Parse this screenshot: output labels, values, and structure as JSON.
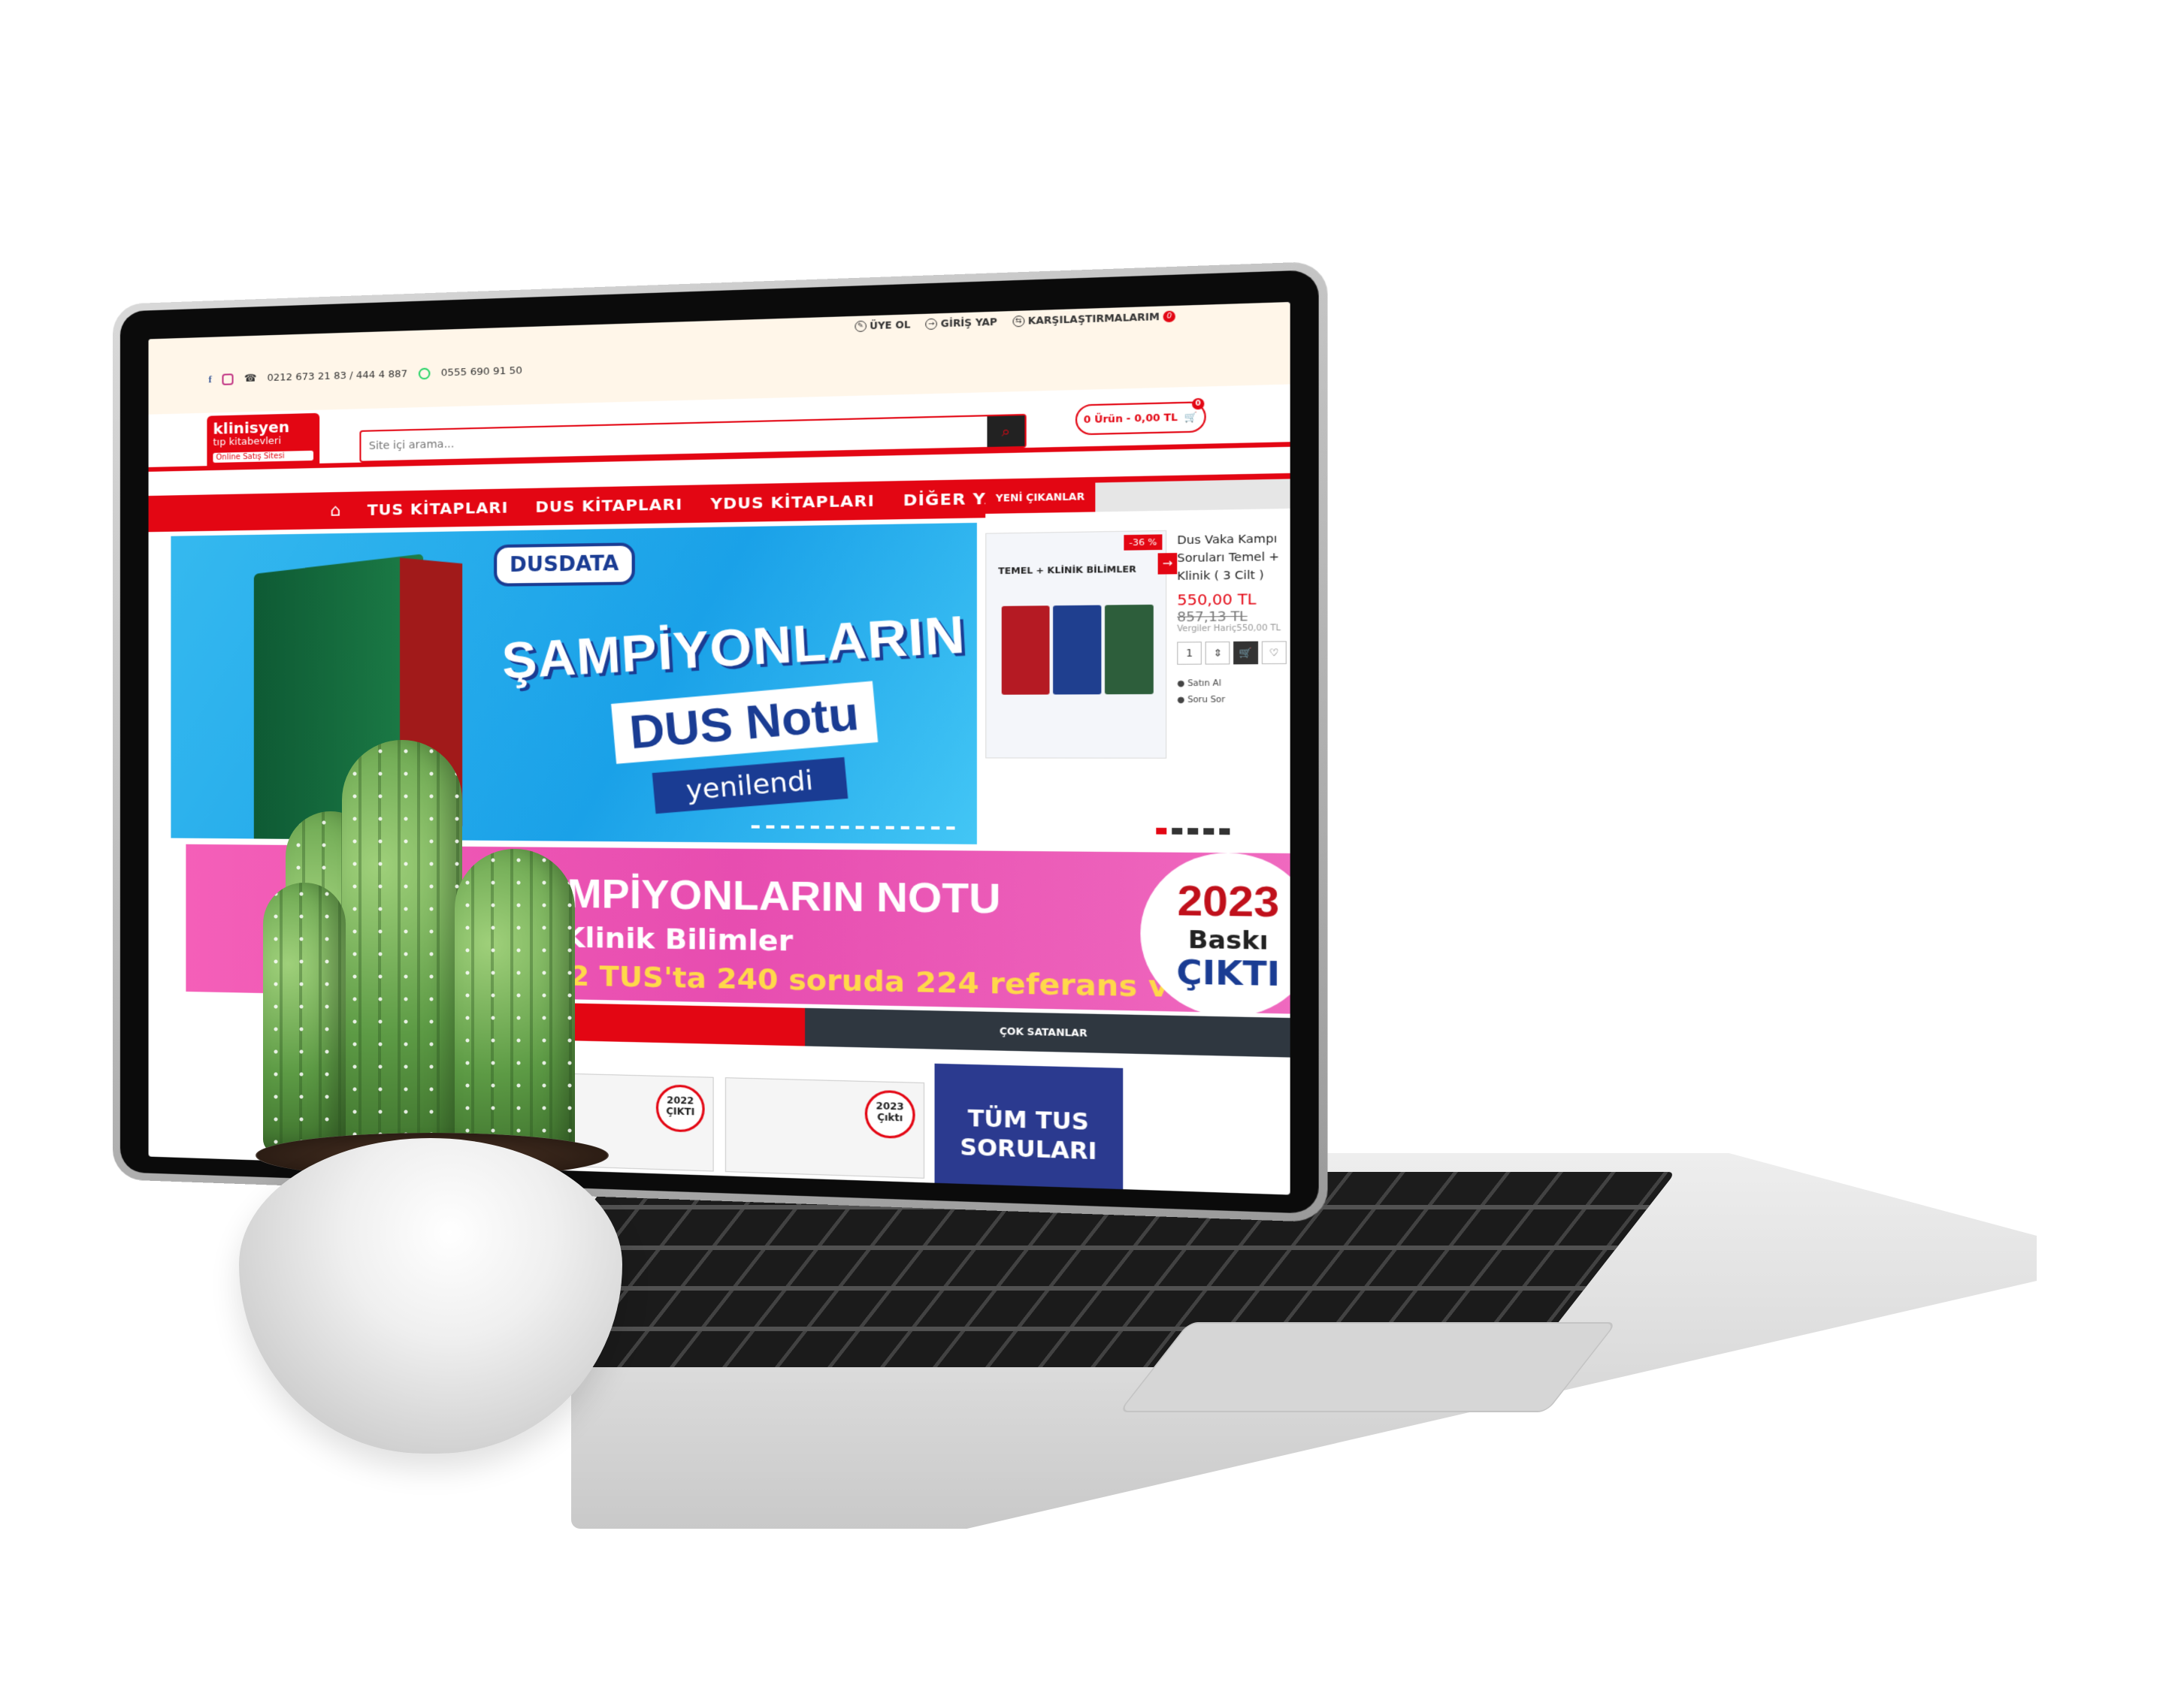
{
  "topbar": {
    "signup": "ÜYE OL",
    "login": "GİRİŞ YAP",
    "compare": "KARŞILAŞTIRMALARIM",
    "compare_count": "0",
    "phones": "0212 673 21 83 / 444 4 887",
    "whatsapp": "0555 690 91 50"
  },
  "logo": {
    "line1": "klinisyen",
    "line2": "tıp kitabevleri",
    "line3": "Online Satış Sitesi"
  },
  "search": {
    "placeholder": "Site içi arama..."
  },
  "cart": {
    "label": "0 Ürün - 0,00 TL",
    "count": "0"
  },
  "nav": {
    "items": [
      "TUS KİTAPLARI",
      "DUS KİTAPLARI",
      "YDUS KİTAPLARI",
      "DİĞER YAYINLAR"
    ]
  },
  "hero": {
    "brand": "DUSDATA",
    "title": "ŞAMPİYONLARIN",
    "subtitle": "DUS Notu",
    "tag": "yenilendi"
  },
  "side": {
    "tab": "YENİ ÇIKANLAR",
    "product": {
      "image_label": "TEMEL + KLİNİK BİLİMLER",
      "discount": "-36 %",
      "name": "Dus Vaka Kampı Soruları Temel + Klinik ( 3 Cilt )",
      "price": "550,00 TL",
      "old_price": "857,13 TL",
      "tax_note": "Vergiler Hariç550,00 TL",
      "qty": "1",
      "buy": "Satın Al",
      "ask": "Soru Sor"
    }
  },
  "promo": {
    "title": "ŞAMPİYONLARIN NOTU",
    "line2": "el+Klinik Bilimler",
    "line3": "2022 TUS'ta 240 soruda 224 referans verdi",
    "badge_year": "2023",
    "badge_word": "Baskı",
    "badge_out": "ÇIKTI"
  },
  "bestsellers": {
    "tab": "ÇOK SATANLAR"
  },
  "cards": [
    {
      "badge": "2023 Çıktı"
    },
    {
      "badge": "2022 ÇIKTI"
    },
    {
      "badge": "2023 Çıktı"
    }
  ],
  "tus_ad": {
    "line1": "TÜM TUS",
    "line2": "SORULARI"
  },
  "colors": {
    "brand_red": "#e30613",
    "dark": "#2f3740",
    "hero_blue": "#1aa1e8",
    "promo_pink": "#e74db0"
  }
}
